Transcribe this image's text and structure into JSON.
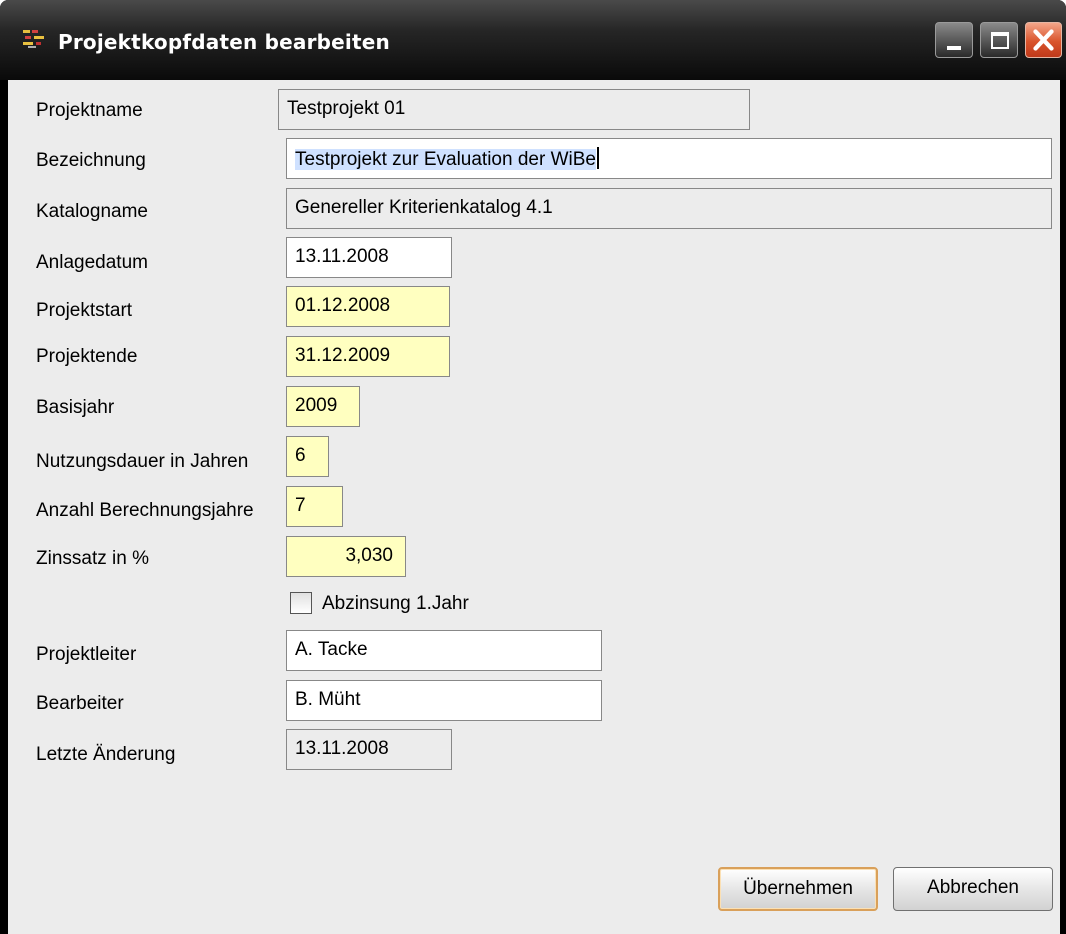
{
  "window": {
    "title": "Projektkopfdaten bearbeiten",
    "icon": "app-icon",
    "controls": [
      "minimize-icon",
      "maximize-icon",
      "close-icon"
    ],
    "accent_close": "#d9542c"
  },
  "form": {
    "projektname": {
      "label": "Projektname",
      "value": "Testprojekt 01"
    },
    "bezeichnung": {
      "label": "Bezeichnung",
      "value": "Testprojekt zur Evaluation der WiBe"
    },
    "katalogname": {
      "label": "Katalogname",
      "value": "Genereller Kriterienkatalog 4.1"
    },
    "anlagedatum": {
      "label": "Anlagedatum",
      "value": "13.11.2008"
    },
    "projektstart": {
      "label": "Projektstart",
      "value": "01.12.2008"
    },
    "projektende": {
      "label": "Projektende",
      "value": "31.12.2009"
    },
    "basisjahr": {
      "label": "Basisjahr",
      "value": "2009"
    },
    "nutzungsdauer": {
      "label": "Nutzungsdauer in Jahren",
      "value": "6"
    },
    "berechnungsjahre": {
      "label": "Anzahl Berechnungsjahre",
      "value": "7"
    },
    "zinssatz": {
      "label": "Zinssatz in %",
      "value": "3,030"
    },
    "abzinsung": {
      "label": "Abzinsung 1.Jahr",
      "checked": false
    },
    "projektleiter": {
      "label": "Projektleiter",
      "value": "A. Tacke"
    },
    "bearbeiter": {
      "label": "Bearbeiter",
      "value": "B. Müht"
    },
    "letzte_aenderung": {
      "label": "Letzte Änderung",
      "value": "13.11.2008"
    }
  },
  "colors": {
    "required_field": "#ffffc0",
    "readonly_field": "#ececec",
    "default_button_border": "#d9a05a"
  },
  "buttons": {
    "ok": "Übernehmen",
    "cancel": "Abbrechen"
  }
}
